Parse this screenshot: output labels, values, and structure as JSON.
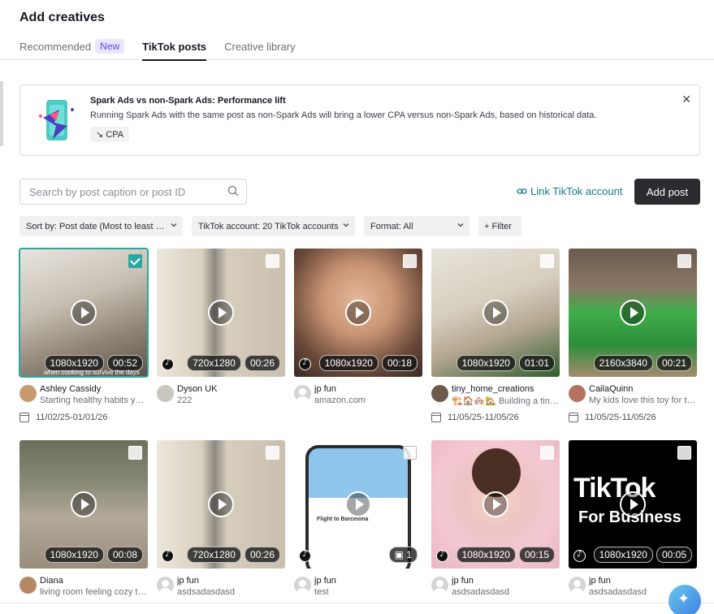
{
  "header": {
    "title": "Add creatives",
    "tabs": [
      {
        "label": "Recommended",
        "badge": "New"
      },
      {
        "label": "TikTok posts"
      },
      {
        "label": "Creative library"
      }
    ],
    "active_tab": "TikTok posts"
  },
  "banner": {
    "title": "Spark Ads vs non-Spark Ads: Performance lift",
    "text": "Running Spark Ads with the same post as non-Spark Ads will bring a lower CPA versus non-Spark Ads, based on historical data.",
    "chip": "↘ CPA",
    "close": "✕"
  },
  "toolbar": {
    "search_placeholder": "Search by post caption or post ID",
    "link_account": "Link TikTok account",
    "add_post": "Add post"
  },
  "filters": {
    "sort": "Sort by: Post date (Most to least recent)",
    "account": "TikTok account: 20 TikTok accounts",
    "format": "Format: All",
    "filter": "+ Filter"
  },
  "posts": [
    {
      "name": "Ashley Cassidy",
      "sub": "Starting healthy habits young",
      "res": "1080x1920",
      "dur": "00:52",
      "date": "11/02/25-01/01/26",
      "checked": true,
      "caption": "when cooking to survive the days"
    },
    {
      "name": "Dyson UK",
      "sub": "222",
      "res": "720x1280",
      "dur": "00:26",
      "date": "",
      "checked": false
    },
    {
      "name": "jp fun",
      "sub": "amazon.com",
      "res": "1080x1920",
      "dur": "00:18",
      "date": "",
      "checked": false
    },
    {
      "name": "tiny_home_creations",
      "sub": "🏗️🏠🏘️🏡 Building a tiny home",
      "res": "1080x1920",
      "dur": "01:01",
      "date": "11/05/25-11/05/26",
      "checked": false
    },
    {
      "name": "CailaQuinn",
      "sub": "My kids love this toy for the holidays",
      "res": "2160x3840",
      "dur": "00:21",
      "date": "11/05/25-11/05/26",
      "checked": false
    },
    {
      "name": "Diana",
      "sub": "living room feeling cozy today",
      "res": "1080x1920",
      "dur": "00:08",
      "date": "",
      "checked": false
    },
    {
      "name": "jp fun",
      "sub": "asdsadasdasd",
      "res": "720x1280",
      "dur": "00:26",
      "date": "",
      "checked": false
    },
    {
      "name": "jp fun",
      "sub": "test",
      "res": "",
      "dur": "1",
      "date": "",
      "checked": false,
      "phone_text": "Flight to Barcelona"
    },
    {
      "name": "jp fun",
      "sub": "asdsadasdasd",
      "res": "1080x1920",
      "dur": "00:15",
      "date": "",
      "checked": false
    },
    {
      "name": "jp fun",
      "sub": "asdsadasdasd",
      "res": "1080x1920",
      "dur": "00:05",
      "date": "",
      "checked": false,
      "logo_line1": "TikTok",
      "logo_line2": "For Business"
    }
  ]
}
